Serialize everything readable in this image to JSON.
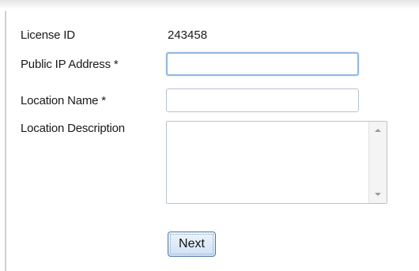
{
  "form": {
    "license_id": {
      "label": "License ID",
      "value": "243458"
    },
    "public_ip": {
      "label": "Public IP Address *",
      "value": "",
      "placeholder": ""
    },
    "location_name": {
      "label": "Location Name *",
      "value": "",
      "placeholder": ""
    },
    "location_description": {
      "label": "Location Description",
      "value": "",
      "placeholder": ""
    },
    "next_label": "Next"
  },
  "icons": {
    "scroll_up": "scroll-up-arrow-icon",
    "scroll_down": "scroll-down-arrow-icon"
  },
  "colors": {
    "focus_border": "#93b8e0",
    "button_border": "#4d7aa8",
    "button_gradient_top": "#eef5fc",
    "button_gradient_bottom": "#cfe1f3"
  }
}
